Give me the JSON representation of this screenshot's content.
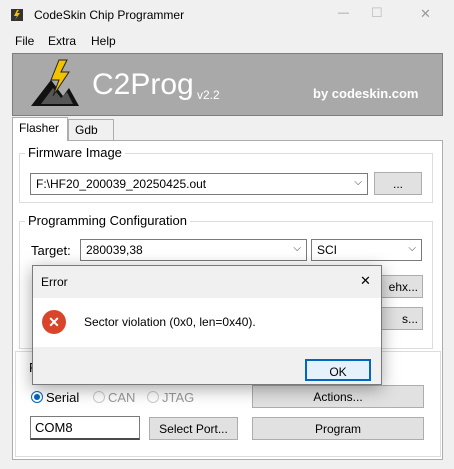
{
  "window": {
    "title": "CodeSkin Chip Programmer",
    "controls": {
      "minimize": "—",
      "maximize": "☐",
      "close": "✕"
    }
  },
  "menu": {
    "items": [
      "File",
      "Extra",
      "Help"
    ]
  },
  "banner": {
    "product": "C2Prog",
    "version": "v2.2",
    "by": "by codeskin.com"
  },
  "tabs": [
    {
      "label": "Flasher",
      "active": true
    },
    {
      "label": "Gdb",
      "active": false
    }
  ],
  "firmware": {
    "group_title": "Firmware Image",
    "path": "F:\\HF20_200039_20250425.out",
    "browse_label": "..."
  },
  "programming": {
    "group_title": "Programming Configuration",
    "target_label": "Target:",
    "target_value": "280039,38",
    "interface_value": "SCI",
    "ehx_button": "ehx...",
    "options_button": "s..."
  },
  "port": {
    "group_title": "P",
    "radios": [
      {
        "label": "Serial",
        "selected": true
      },
      {
        "label": "CAN",
        "selected": false
      },
      {
        "label": "JTAG",
        "selected": false
      }
    ],
    "port_value": "COM8",
    "select_port_button": "Select Port...",
    "actions_button": "Actions...",
    "program_button": "Program"
  },
  "dialog": {
    "title": "Error",
    "close": "✕",
    "message": "Sector violation (0x0, len=0x40).",
    "icon_glyph": "✕",
    "ok_label": "OK"
  },
  "colors": {
    "banner_bg": "#a9a9a9",
    "error_red": "#d9452b",
    "accent": "#0067c0",
    "logo_yellow": "#f2c200"
  }
}
